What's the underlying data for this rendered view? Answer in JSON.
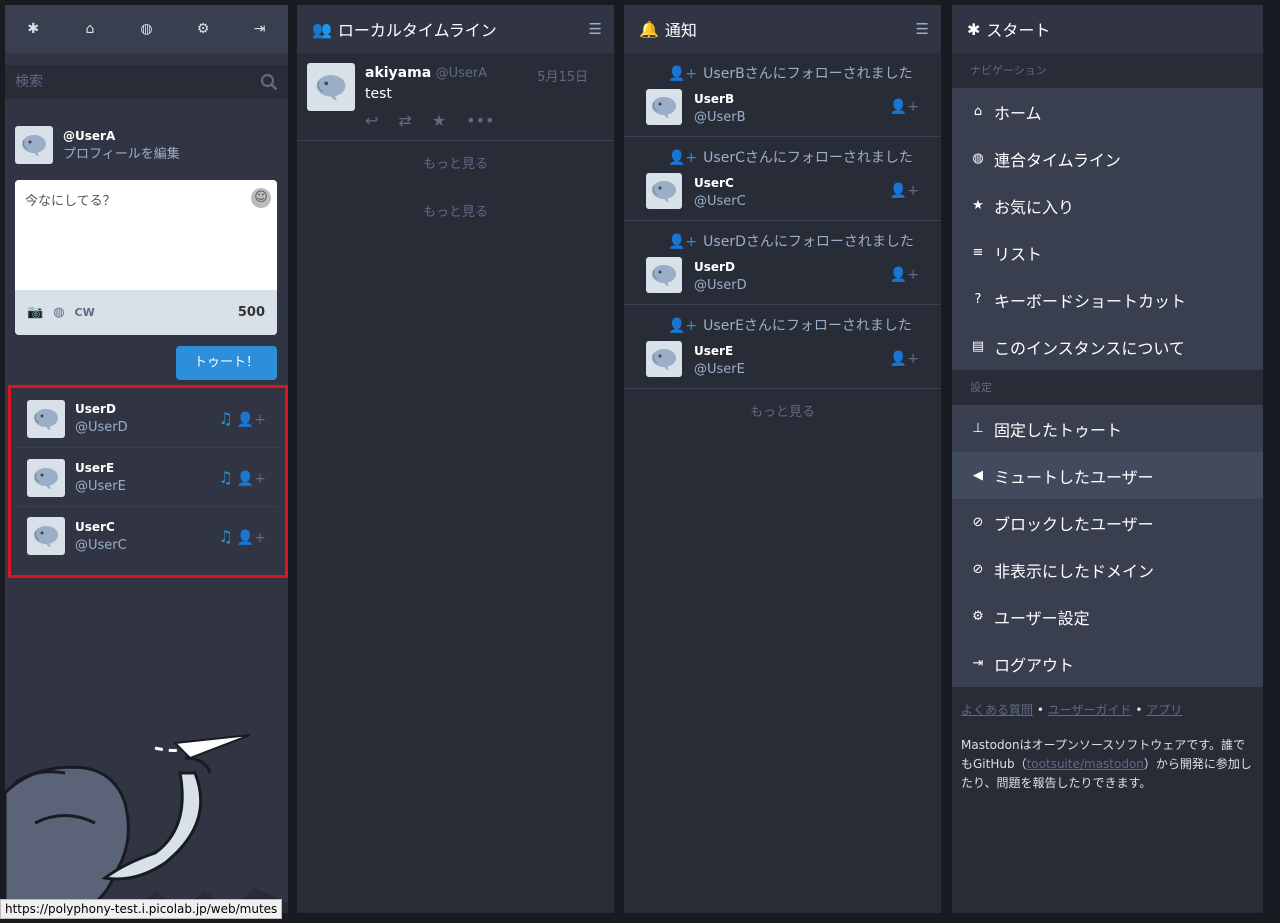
{
  "left": {
    "nav_icons": [
      "asterisk-icon",
      "home-icon",
      "globe-icon",
      "gear-icon",
      "logout-icon"
    ],
    "search": {
      "placeholder": "検索"
    },
    "account": {
      "handle": "@UserA",
      "edit_label": "プロフィールを編集"
    },
    "compose": {
      "placeholder": "今なにしてる？",
      "cw_label": "CW",
      "counter": "500",
      "toot_label": "トゥート！"
    },
    "results": [
      {
        "name": "UserD",
        "handle": "@UserD"
      },
      {
        "name": "UserE",
        "handle": "@UserE"
      },
      {
        "name": "UserC",
        "handle": "@UserC"
      }
    ]
  },
  "local": {
    "title": "ローカルタイムライン",
    "status": {
      "name": "akiyama",
      "handle": "@UserA",
      "date": "5月15日",
      "text": "test"
    },
    "more1": "もっと見る",
    "more2": "もっと見る"
  },
  "notifications": {
    "title": "通知",
    "items": [
      {
        "header": "UserBさんにフォローされました",
        "name": "UserB",
        "handle": "@UserB"
      },
      {
        "header": "UserCさんにフォローされました",
        "name": "UserC",
        "handle": "@UserC"
      },
      {
        "header": "UserDさんにフォローされました",
        "name": "UserD",
        "handle": "@UserD"
      },
      {
        "header": "UserEさんにフォローされました",
        "name": "UserE",
        "handle": "@UserE"
      }
    ],
    "more": "もっと見る"
  },
  "start": {
    "title": "スタート",
    "nav_section": "ナビゲーション",
    "nav": [
      "ホーム",
      "連合タイムライン",
      "お気に入り",
      "リスト",
      "キーボードショートカット",
      "このインスタンスについて"
    ],
    "settings_section": "設定",
    "settings": [
      "固定したトゥート",
      "ミュートしたユーザー",
      "ブロックしたユーザー",
      "非表示にしたドメイン",
      "ユーザー設定",
      "ログアウト"
    ],
    "links": {
      "faq": "よくある質問",
      "guide": "ユーザーガイド",
      "apps": "アプリ"
    },
    "about_pre": "Mastodonはオープンソースソフトウェアです。誰でもGitHub（",
    "about_link": "tootsuite/mastodon",
    "about_post": "）から開発に参加したり、問題を報告したりできます。"
  },
  "status_url": "https://polyphony-test.i.picolab.jp/web/mutes"
}
